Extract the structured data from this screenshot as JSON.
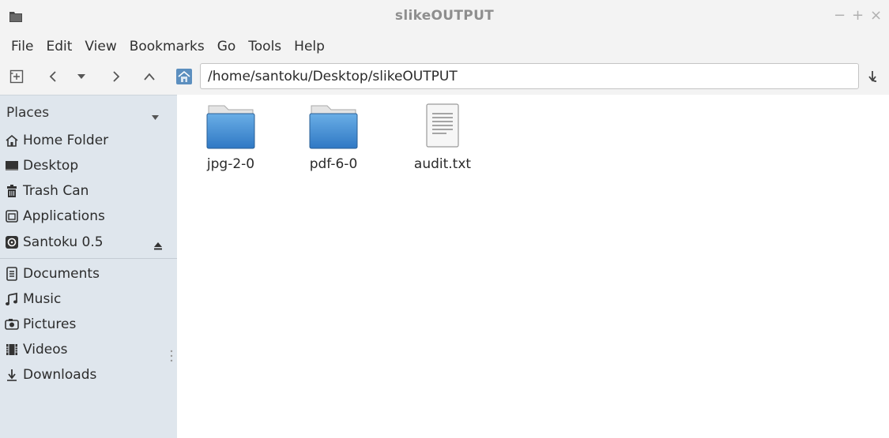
{
  "window": {
    "title": "slikeOUTPUT",
    "controls": {
      "minimize": "−",
      "maximize": "+",
      "close": "×"
    }
  },
  "menu": [
    "File",
    "Edit",
    "View",
    "Bookmarks",
    "Go",
    "Tools",
    "Help"
  ],
  "toolbar": {
    "path": "/home/santoku/Desktop/slikeOUTPUT",
    "buttons": [
      "new-tab-icon",
      "back-icon",
      "history-dropdown-icon",
      "forward-icon",
      "up-icon",
      "home-icon",
      "go-icon"
    ]
  },
  "sidebar": {
    "header": "Places",
    "items": [
      {
        "label": "Home Folder",
        "icon": "home-icon"
      },
      {
        "label": "Desktop",
        "icon": "desktop-icon"
      },
      {
        "label": "Trash Can",
        "icon": "trash-icon"
      },
      {
        "label": "Applications",
        "icon": "applications-icon"
      },
      {
        "label": "Santoku 0.5",
        "icon": "disc-icon"
      },
      {
        "label": "Documents",
        "icon": "documents-icon"
      },
      {
        "label": "Music",
        "icon": "music-icon"
      },
      {
        "label": "Pictures",
        "icon": "pictures-icon"
      },
      {
        "label": "Videos",
        "icon": "videos-icon"
      },
      {
        "label": "Downloads",
        "icon": "downloads-icon"
      }
    ]
  },
  "files": [
    {
      "name": "jpg-2-0",
      "type": "folder"
    },
    {
      "name": "pdf-6-0",
      "type": "folder"
    },
    {
      "name": "audit.txt",
      "type": "text-file"
    }
  ],
  "colors": {
    "sidebar_bg": "#dfe6ed",
    "chrome_bg": "#f3f3f3",
    "folder_blue": "#4a8fd3"
  }
}
